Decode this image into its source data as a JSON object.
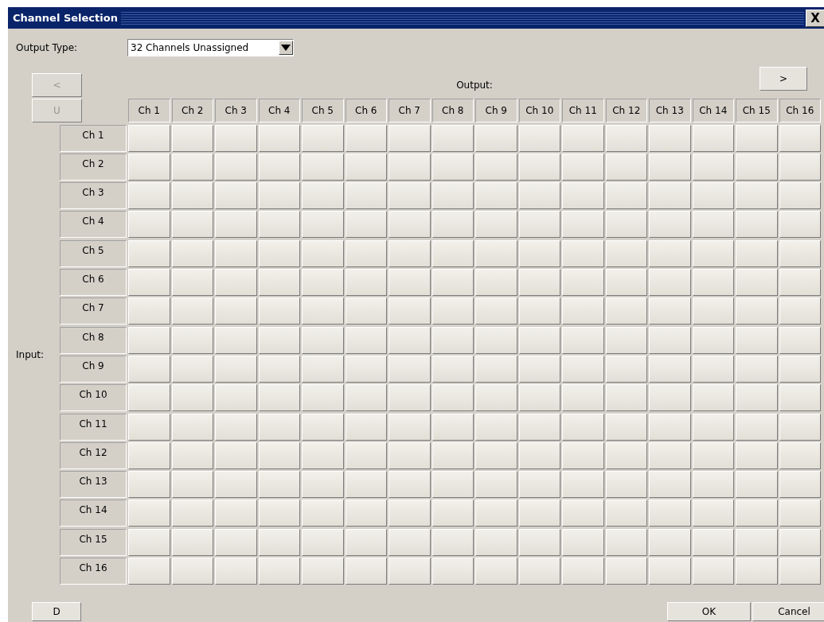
{
  "window": {
    "title": "Channel Selection",
    "close": "X"
  },
  "output_type": {
    "label": "Output Type:",
    "value": "32 Channels Unassigned"
  },
  "nav_buttons": [
    {
      "label": "<",
      "disabled": true
    },
    {
      "label": "U",
      "disabled": true
    },
    {
      "label": ">",
      "disabled": false
    }
  ],
  "output_label": "Output:",
  "input_label": "Input:",
  "columns": [
    "Ch 1",
    "Ch 2",
    "Ch 3",
    "Ch 4",
    "Ch 5",
    "Ch 6",
    "Ch 7",
    "Ch 8",
    "Ch 9",
    "Ch 10",
    "Ch 11",
    "Ch 12",
    "Ch 13",
    "Ch 14",
    "Ch 15",
    "Ch 16"
  ],
  "rows": [
    "Ch 1",
    "Ch 2",
    "Ch 3",
    "Ch 4",
    "Ch 5",
    "Ch 6",
    "Ch 7",
    "Ch 8",
    "Ch 9",
    "Ch 10",
    "Ch 11",
    "Ch 12",
    "Ch 13",
    "Ch 14",
    "Ch 15",
    "Ch 16"
  ],
  "footer_buttons": [
    "D",
    "OK",
    "Cancel"
  ]
}
